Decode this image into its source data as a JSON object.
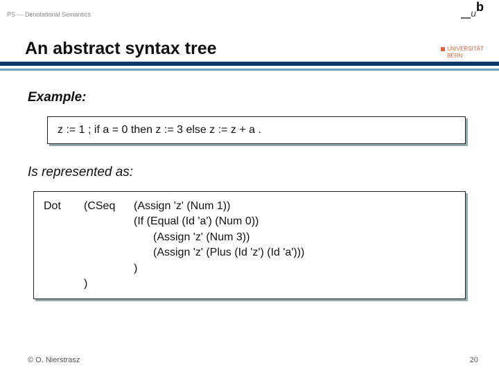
{
  "header": {
    "topic": "PS — Denotational Semantics",
    "title": "An abstract syntax tree",
    "university_line1": "UNIVERSITÄT",
    "university_line2": "BERN"
  },
  "body": {
    "example_label": "Example:",
    "example_code": "z := 1 ; if a = 0 then z := 3 else z := z + a .",
    "represented_label": "Is represented as:",
    "ast": {
      "root": "Dot",
      "seq": "(CSeq",
      "line1": "(Assign 'z' (Num 1))",
      "line2": "(If (Equal (Id 'a') (Num 0))",
      "line3": "(Assign 'z' (Num 3))",
      "line4": "(Assign 'z' (Plus (Id 'z') (Id 'a')))",
      "close_if": ")",
      "close_seq": ")"
    }
  },
  "footer": {
    "copyright": "© O. Nierstrasz",
    "page": "20"
  }
}
